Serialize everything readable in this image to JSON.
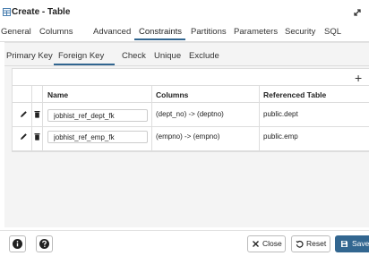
{
  "window": {
    "title": "Create - Table",
    "more_glyph": "⋮"
  },
  "tabs": [
    {
      "label": "General"
    },
    {
      "label": "Columns"
    },
    {
      "label": "Advanced"
    },
    {
      "label": "Constraints"
    },
    {
      "label": "Partitions"
    },
    {
      "label": "Parameters"
    },
    {
      "label": "Security"
    },
    {
      "label": "SQL"
    }
  ],
  "active_tab": "Constraints",
  "subtabs": [
    {
      "label": "Primary Key"
    },
    {
      "label": "Foreign Key"
    },
    {
      "label": "Check"
    },
    {
      "label": "Unique"
    },
    {
      "label": "Exclude"
    }
  ],
  "active_subtab": "Foreign Key",
  "grid": {
    "add_label": "+",
    "headers": {
      "name": "Name",
      "columns": "Columns",
      "referenced_table": "Referenced Table"
    },
    "rows": [
      {
        "name": "jobhist_ref_dept_fk",
        "columns": "(dept_no) -> (deptno)",
        "referenced_table": "public.dept"
      },
      {
        "name": "jobhist_ref_emp_fk",
        "columns": "(empno) -> (empno)",
        "referenced_table": "public.emp"
      }
    ]
  },
  "footer": {
    "close_label": "Close",
    "reset_label": "Reset",
    "save_label": "Save"
  },
  "colors": {
    "accent": "#326690",
    "panel_bg": "#f4f4f4",
    "border": "#dddddd"
  }
}
